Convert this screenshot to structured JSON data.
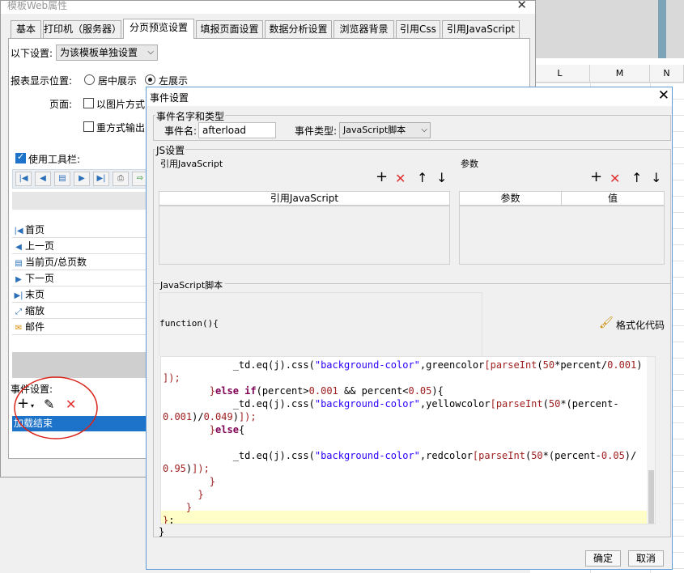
{
  "background_sheet": {
    "column_headers": [
      "L",
      "M",
      "N"
    ]
  },
  "main_dialog": {
    "title": "模板Web属性",
    "tabs": [
      "基本",
      "打印机（服务器）",
      "分页预览设置",
      "填报页面设置",
      "数据分析设置",
      "浏览器背景",
      "引用Css",
      "引用JavaScript"
    ],
    "active_tab": "分页预览设置",
    "settings_label": "以下设置:",
    "settings_value": "为该模板单独设置",
    "position_label": "报表显示位置:",
    "position_center": "居中展示",
    "position_left": "左展示",
    "page_label": "页面:",
    "page_option_image": "以图片方式",
    "page_option_redo": "重方式输出",
    "use_toolbar_label": "使用工具栏:",
    "toolbar_items": [
      {
        "label": "首页",
        "icon": "first-page-icon"
      },
      {
        "label": "上一页",
        "icon": "prev-page-icon"
      },
      {
        "label": "当前页/总页数",
        "icon": "page-count-icon"
      },
      {
        "label": "下一页",
        "icon": "next-page-icon"
      },
      {
        "label": "末页",
        "icon": "last-page-icon"
      },
      {
        "label": "缩放",
        "icon": "zoom-icon"
      },
      {
        "label": "邮件",
        "icon": "mail-icon"
      }
    ],
    "event_settings_label": "事件设置:",
    "event_list": [
      "加载结束"
    ]
  },
  "event_dialog": {
    "title": "事件设置",
    "name_type_group": "事件名字和类型",
    "event_name_label": "事件名:",
    "event_name_value": "afterload",
    "event_type_label": "事件类型:",
    "event_type_value": "JavaScript脚本",
    "js_group": "JS设置",
    "ref_js_label": "引用JavaScript",
    "params_label": "参数",
    "ref_js_column": "引用JavaScript",
    "params_columns": [
      "参数",
      "值"
    ],
    "script_label": "JavaScript脚本",
    "function_header": "function(){",
    "format_code_label": "格式化代码",
    "closing_brace": "}",
    "ok_label": "确定",
    "cancel_label": "取消",
    "code_lines": [
      "            _td.eq(j).css(\"background-color\",greencolor[parseInt(50*percent/0.001)",
      "]);",
      "        }else if(percent>0.001 && percent<0.05){",
      "            _td.eq(j).css(\"background-color\",yellowcolor[parseInt(50*(percent-",
      "0.001)/0.049)]);",
      "        }else{",
      "",
      "            _td.eq(j).css(\"background-color\",redcolor[parseInt(50*(percent-0.05)/",
      "0.95)]);",
      "        }",
      "      }",
      "    }",
      "};"
    ]
  },
  "colors": {
    "accent": "#1d73c9",
    "annotation_circle": "#d9251c",
    "highlight_line": "#fffdc8"
  }
}
